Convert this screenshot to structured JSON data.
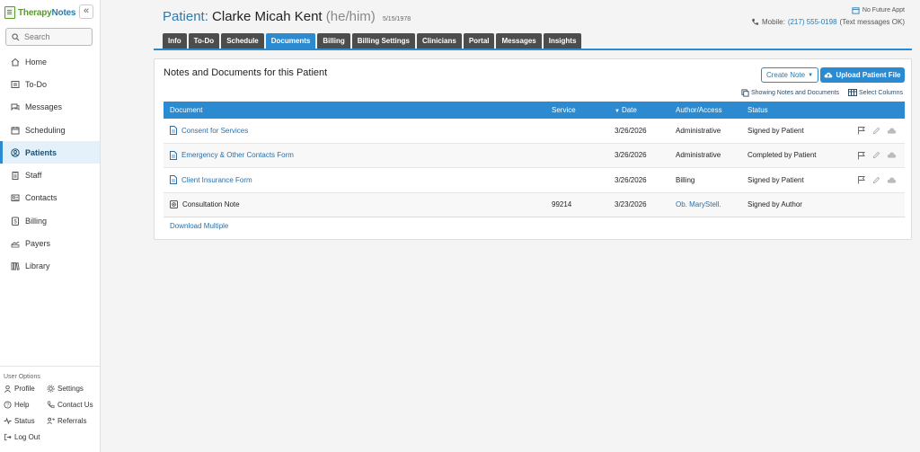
{
  "app": {
    "logo_part1": "Therapy",
    "logo_part2": "Notes",
    "collapse_label": "«"
  },
  "search": {
    "placeholder": "Search"
  },
  "nav": {
    "items": [
      {
        "label": "Home",
        "icon": "home-icon"
      },
      {
        "label": "To-Do",
        "icon": "list-icon"
      },
      {
        "label": "Messages",
        "icon": "messages-icon"
      },
      {
        "label": "Scheduling",
        "icon": "calendar-icon"
      },
      {
        "label": "Patients",
        "icon": "user-circle-icon",
        "active": true
      },
      {
        "label": "Staff",
        "icon": "clipboard-icon"
      },
      {
        "label": "Contacts",
        "icon": "contact-card-icon"
      },
      {
        "label": "Billing",
        "icon": "dollar-icon"
      },
      {
        "label": "Payers",
        "icon": "payers-icon"
      },
      {
        "label": "Library",
        "icon": "library-icon"
      }
    ]
  },
  "user_options": {
    "title": "User Options",
    "profile": "Profile",
    "settings": "Settings",
    "help": "Help",
    "contact_us": "Contact Us",
    "status": "Status",
    "referrals": "Referrals",
    "log_out": "Log Out"
  },
  "patient": {
    "label": "Patient:",
    "name": "Clarke Micah Kent",
    "pronouns": "(he/him)",
    "dob": "5/15/1978",
    "future_appt": "No Future Appt",
    "mobile_label": "Mobile:",
    "phone": "(217) 555-0198",
    "phone_note": "(Text messages OK)"
  },
  "tabs": [
    {
      "label": "Info"
    },
    {
      "label": "To-Do"
    },
    {
      "label": "Schedule"
    },
    {
      "label": "Documents",
      "active": true
    },
    {
      "label": "Billing"
    },
    {
      "label": "Billing Settings"
    },
    {
      "label": "Clinicians"
    },
    {
      "label": "Portal"
    },
    {
      "label": "Messages"
    },
    {
      "label": "Insights"
    }
  ],
  "panel": {
    "title": "Notes and Documents for this Patient",
    "create_note": "Create Note",
    "upload_file": "Upload Patient File",
    "showing": "Showing Notes and Documents",
    "select_columns": "Select Columns",
    "download_multiple": "Download Multiple"
  },
  "table": {
    "headers": {
      "document": "Document",
      "service": "Service",
      "date_sort": "▼",
      "date": "Date",
      "author": "Author/Access",
      "status": "Status"
    },
    "rows": [
      {
        "document": "Consent for Services",
        "service": "",
        "date": "3/26/2026",
        "author": "Administrative",
        "status": "Signed by Patient"
      },
      {
        "document": "Emergency & Other Contacts Form",
        "service": "",
        "date": "3/26/2026",
        "author": "Administrative",
        "status": "Completed by Patient"
      },
      {
        "document": "Client Insurance Form",
        "service": "",
        "date": "3/26/2026",
        "author": "Billing",
        "status": "Signed by Patient"
      },
      {
        "document": "Consultation Note",
        "service": "99214",
        "date": "3/23/2026",
        "author": "Ob. MaryStell.",
        "status": "Signed by Author"
      }
    ]
  },
  "colors": {
    "accent": "#2b8ad0",
    "tab_dark": "#4d4d4d",
    "link": "#2b6fa8",
    "brand_green": "#5a9a2e"
  }
}
